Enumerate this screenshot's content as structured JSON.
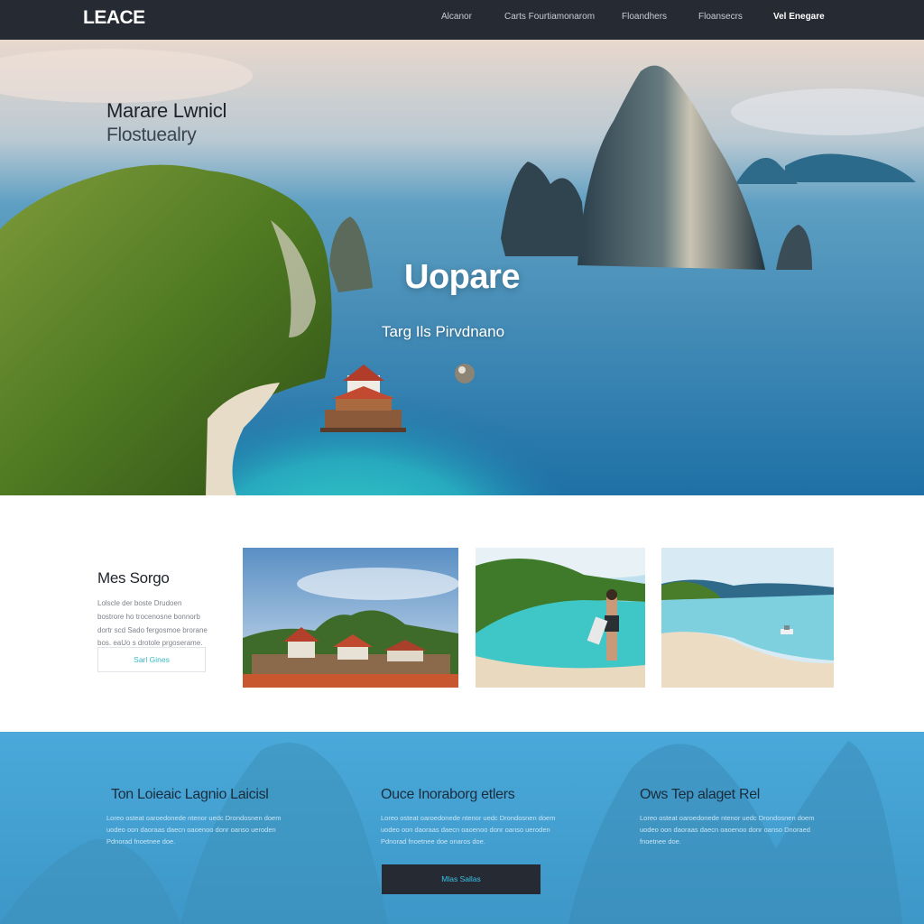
{
  "nav": {
    "logo": "LEACE",
    "links": [
      "Alcanor",
      "Carts Fourtiamonarom",
      "Floandhers",
      "Floansecrs",
      "Vel Enegare"
    ]
  },
  "hero": {
    "kicker": "Marare Lwnicl",
    "kicker_sub": "Flostuealry",
    "title": "Uopare",
    "subtitle": "Targ Ils Pirvdnano"
  },
  "feature": {
    "title": "Mes Sorgo",
    "body": "Lolscle der boste Drudoen bostrore ho trocenosne bonnorb dortr scd Sado fergosmoe brorane bos. eaUo s drotole prgoserame.",
    "button_label": "Sarl Gines"
  },
  "columns": [
    {
      "title": "Ton Loieaic  Lagnio Laicisl",
      "body": "Loreo osteat oaroedonede ntenor uedc Drondosnen doem uodeo oon daoraas daecn oaoenoo donr oanso ueroden Pdnorad fnoetnee doe."
    },
    {
      "title": "Ouce Inoraborg etlers",
      "body": "Loreo osteat oaroedonede ntenor uedc Drondosnen doem uodeo oon daoraas daecn oaoenoo donr oanso ueroden Pdnorad fnoetnee doe onaros doe."
    },
    {
      "title": "Ows Tep alaget Rel",
      "body": "Loreo osteat oaroedonede ntenor uedc Drondosnen doem uodeo oon daoraas daecn oaoenoo donr oanso Dnoraed fnoetnee doe."
    }
  ],
  "cta_label": "Mlas Sallas",
  "colors": {
    "nav_bg": "#262a33",
    "accent": "#39c1ea",
    "bottom_bg": "#48a6d6",
    "water": "#2fb8c4"
  }
}
